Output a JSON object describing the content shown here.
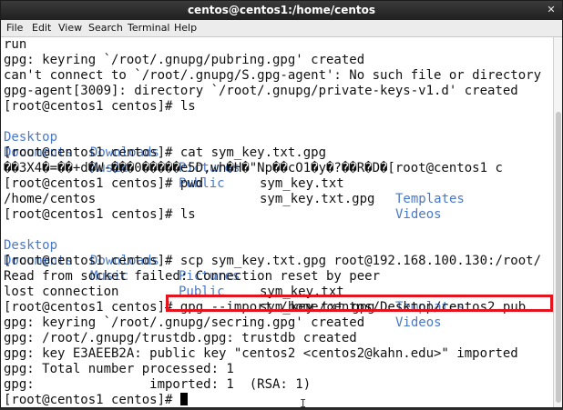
{
  "window": {
    "title": "centos@centos1:/home/centos"
  },
  "menu": {
    "items": [
      "File",
      "Edit",
      "View",
      "Search",
      "Terminal",
      "Help"
    ]
  },
  "terminal": {
    "lines": [
      "run",
      "gpg: keyring `/root/.gnupg/pubring.gpg' created",
      "can't connect to `/root/.gnupg/S.gpg-agent': No such file or directory",
      "gpg-agent[3009]: directory `/root/.gnupg/private-keys-v1.d' created",
      "[root@centos1 centos]# ls",
      "",
      "",
      "[root@centos1 centos]# cat sym_key.txt.gpg",
      "��3X4�=��+d�W-���0�����e5D,wh�H�\"Np��cO1�y�?��R�D�[root@centos1 c",
      "[root@centos1 centos]# pwd",
      "/home/centos",
      "[root@centos1 centos]# ls",
      "",
      "",
      "[root@centos1 centos]# scp sym_key.txt.gpg root@192.168.100.130:/root/",
      "Read from socket failed: Connection reset by peer",
      "lost connection",
      "[root@centos1 centos]# gpg --import /home/centos/Desktop/centos2.pub",
      "gpg: keyring `/root/.gnupg/secring.gpg' created",
      "gpg: /root/.gnupg/trustdb.gpg: trustdb created",
      "gpg: key E3AEEB2A: public key \"centos2 <centos2@kahn.edu>\" imported",
      "gpg: Total number processed: 1",
      "gpg:               imported: 1  (RSA: 1)",
      "[root@centos1 centos]# "
    ],
    "ls_output": {
      "row1": {
        "c1": "Desktop",
        "c2": "Downloads",
        "c3": "Pictures",
        "c4": "sym_key.txt",
        "c5": "Templates"
      },
      "row2": {
        "c1": "Documents",
        "c2": "Music",
        "c3": "Public",
        "c4": "sym_key.txt.gpg",
        "c5": "Videos"
      }
    }
  },
  "colors": {
    "directory": "#4a78c8",
    "highlight": "#e3141d"
  }
}
